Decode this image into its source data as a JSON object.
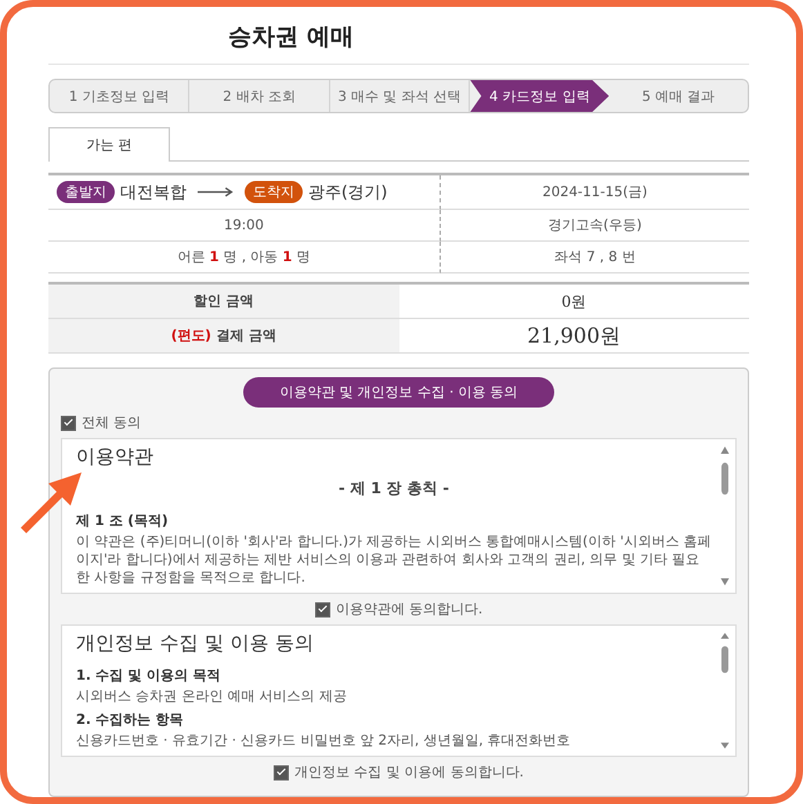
{
  "title": "승차권 예매",
  "steps": [
    {
      "label": "1 기초정보 입력",
      "selected": false
    },
    {
      "label": "2 배차 조회",
      "selected": false
    },
    {
      "label": "3 매수 및 좌석 선택",
      "selected": false
    },
    {
      "label": "4 카드정보 입력",
      "selected": true
    },
    {
      "label": "5 예매 결과",
      "selected": false
    }
  ],
  "tabs": [
    {
      "label": "가는 편",
      "selected": true
    }
  ],
  "trip": {
    "departure_badge": "출발지",
    "departure": "대전복합",
    "arrival_badge": "도착지",
    "arrival": "광주(경기)",
    "date": "2024-11-15(금)",
    "time": "19:00",
    "company": "경기고속(우등)",
    "passengers": "어른 **1** 명 , 아동 **1** 명",
    "seats": "좌석 7 , 8 번"
  },
  "prices": [
    {
      "label": "할인 금액",
      "value": "0원",
      "kind": "plain"
    },
    {
      "label": "**(편도)** 결제 금액",
      "value": "21,900원",
      "kind": "total"
    }
  ],
  "agreement": {
    "button": "이용약관 및 개인정보 수집 · 이용 동의",
    "agree_all": {
      "label": "전체 동의",
      "checked": true
    },
    "sections": [
      {
        "title": "이용약관",
        "chapter": "- 제 1 장 총칙 -",
        "heading": "제 1 조 (목적)",
        "body": "이 약관은 (주)티머니(이하 '회사'라 합니다.)가 제공하는 시외버스 통합예매시스템(이하 '시외버스 홈페이지'라 합니다)에서 제공하는 제반 서비스의 이용과 관련하여 회사와 고객의 권리, 의무 및 기타 필요한 사항을 규정함을 목적으로 합니다.",
        "consent": {
          "label": "이용약관에 동의합니다.",
          "checked": true
        }
      },
      {
        "title": "개인정보 수집 및 이용 동의",
        "items": [
          {
            "heading": "1. 수집 및 이용의 목적",
            "body": "시외버스 승차권 온라인 예매 서비스의 제공"
          },
          {
            "heading": "2. 수집하는 항목",
            "body": "신용카드번호 · 유효기간 · 신용카드 비밀번호 앞 2자리, 생년월일, 휴대전화번호"
          }
        ],
        "consent": {
          "label": "개인정보 수집 및 이용에 동의합니다.",
          "checked": true
        }
      }
    ]
  }
}
